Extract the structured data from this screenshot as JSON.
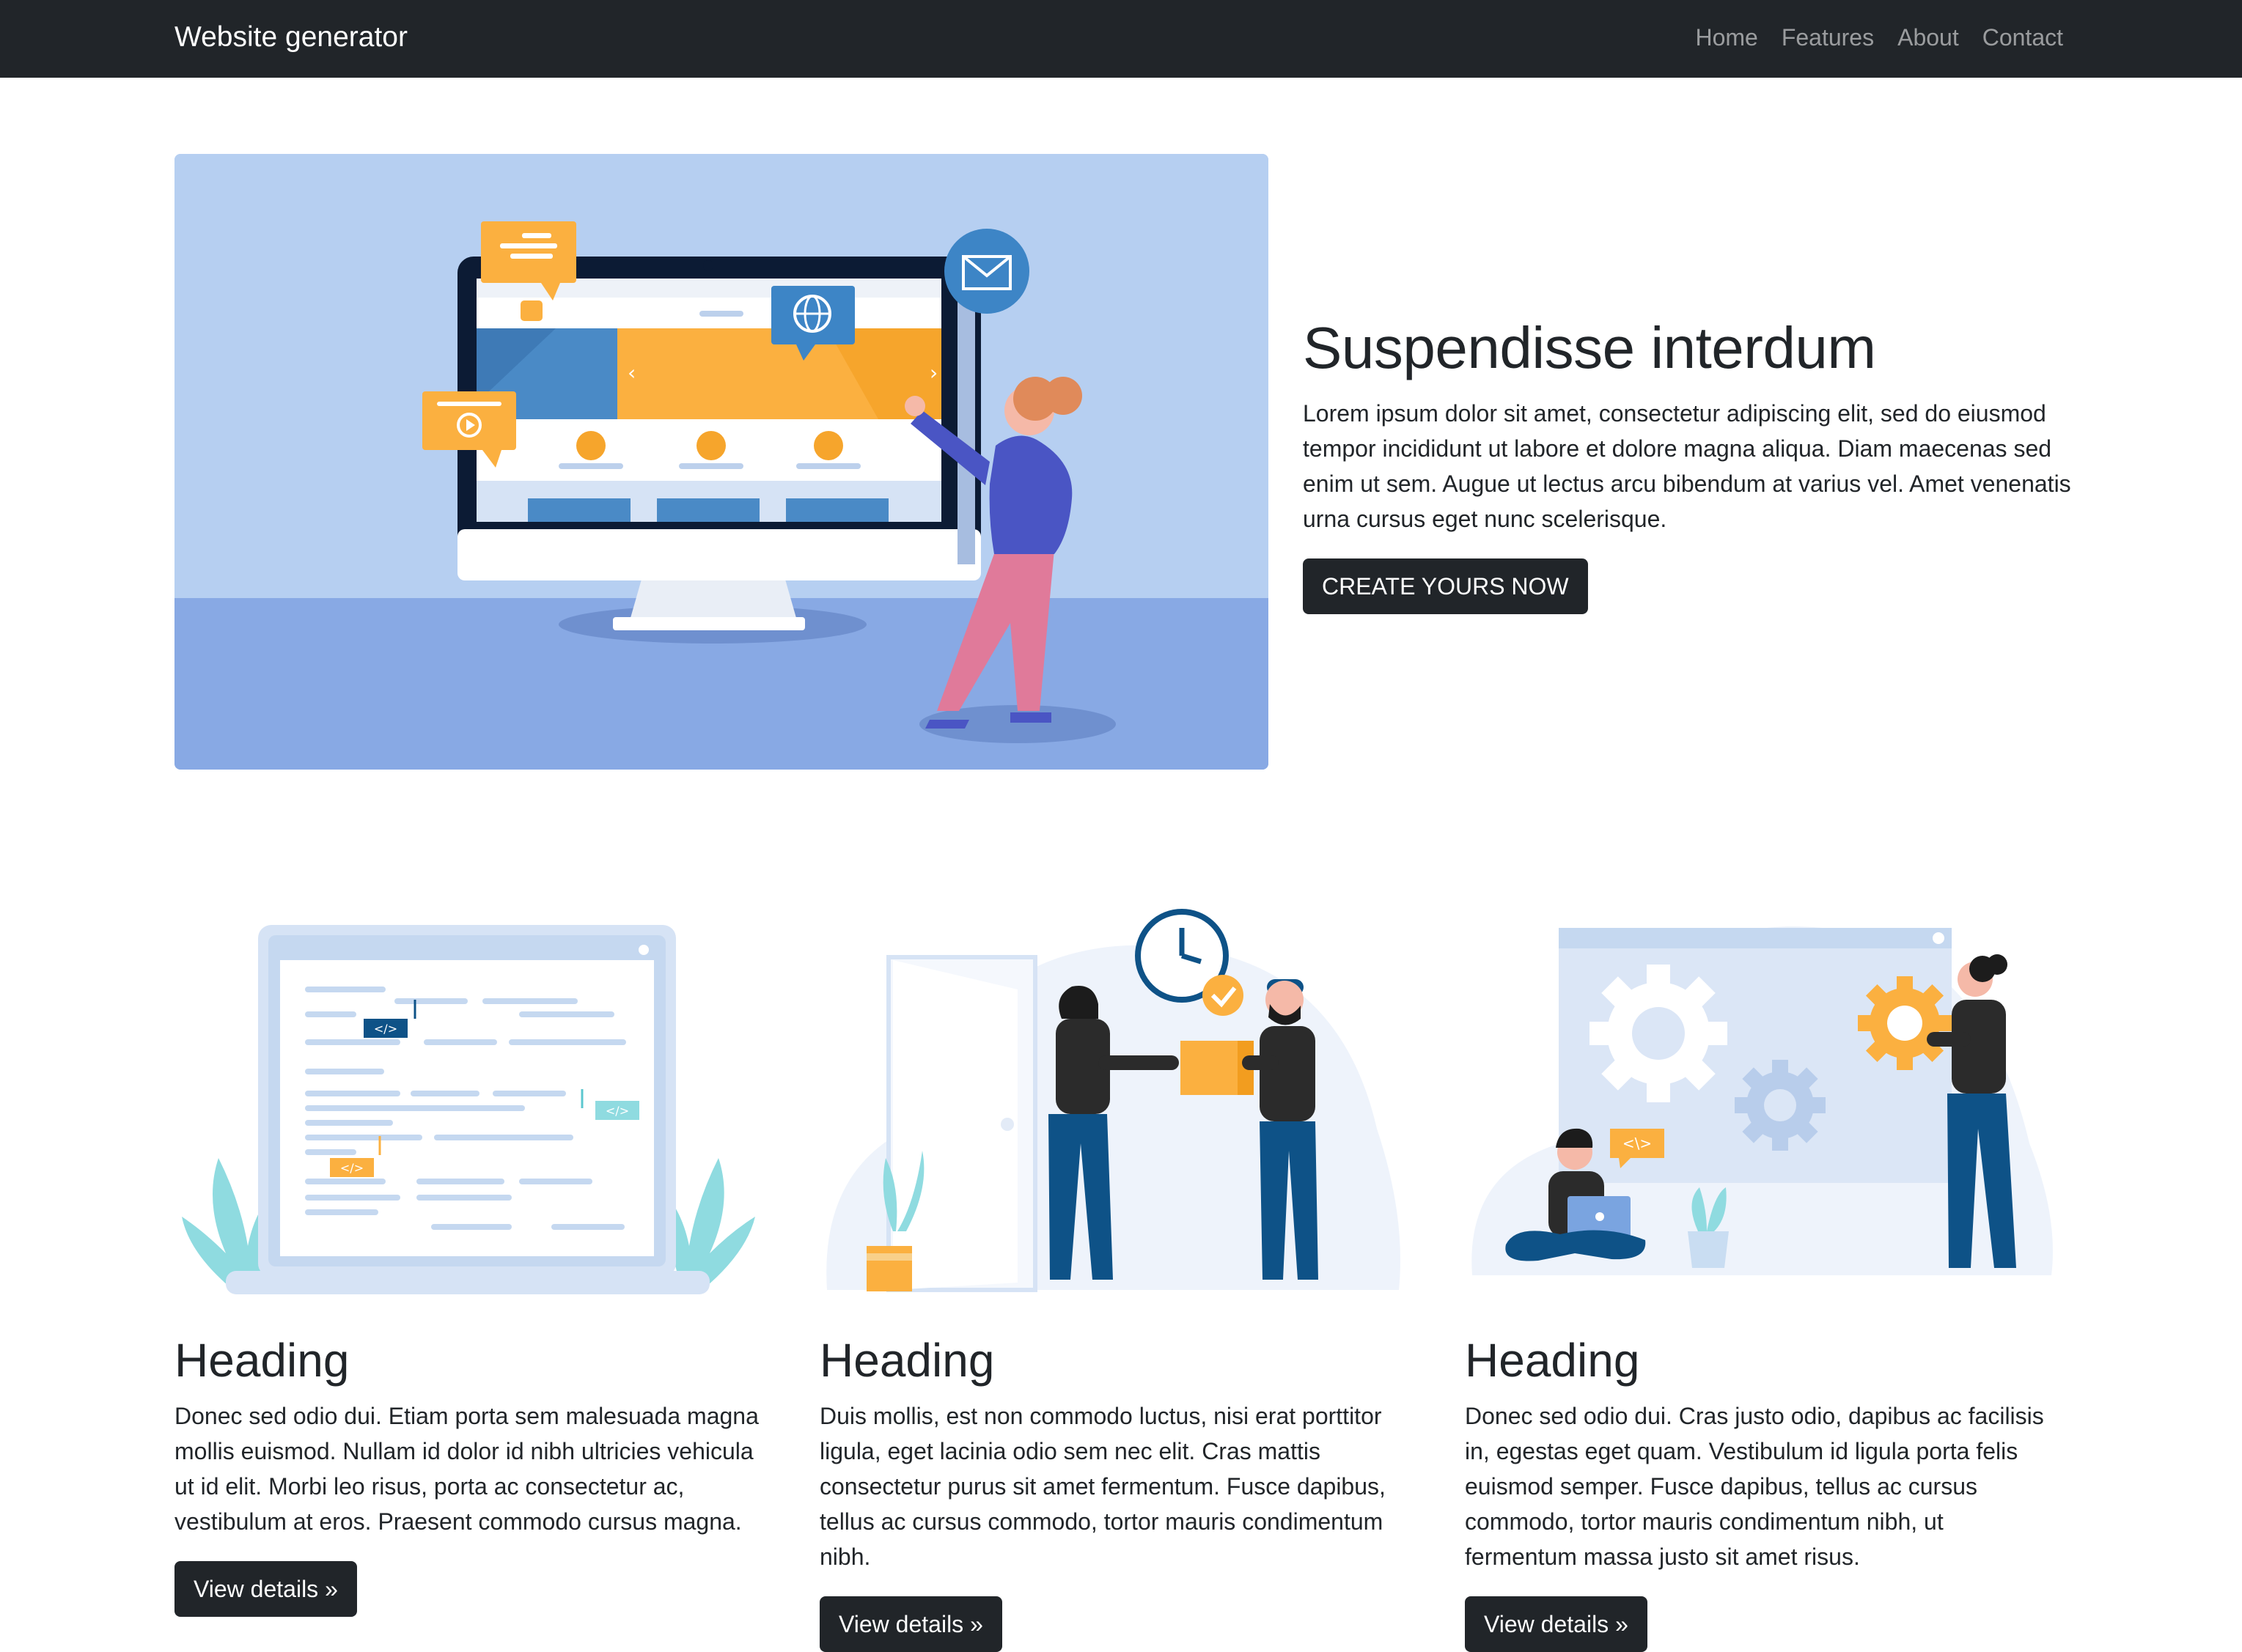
{
  "navbar": {
    "brand": "Website generator",
    "links": [
      "Home",
      "Features",
      "About",
      "Contact"
    ]
  },
  "hero": {
    "title": "Suspendisse interdum",
    "text": "Lorem ipsum dolor sit amet, consectetur adipiscing elit, sed do eiusmod tempor incididunt ut labore et dolore magna aliqua. Diam maecenas sed enim ut sem. Augue ut lectus arcu bibendum at varius vel. Amet venenatis urna cursus eget nunc scelerisque.",
    "button": "CREATE YOURS NOW"
  },
  "features": [
    {
      "heading": "Heading",
      "text": "Donec sed odio dui. Etiam porta sem malesuada magna mollis euismod. Nullam id dolor id nibh ultricies vehicula ut id elit. Morbi leo risus, porta ac consectetur ac, vestibulum at eros. Praesent commodo cursus magna.",
      "button": "View details »"
    },
    {
      "heading": "Heading",
      "text": "Duis mollis, est non commodo luctus, nisi erat porttitor ligula, eget lacinia odio sem nec elit. Cras mattis consectetur purus sit amet fermentum. Fusce dapibus, tellus ac cursus commodo, tortor mauris condimentum nibh.",
      "button": "View details »"
    },
    {
      "heading": "Heading",
      "text": "Donec sed odio dui. Cras justo odio, dapibus ac facilisis in, egestas eget quam. Vestibulum id ligula porta felis euismod semper. Fusce dapibus, tellus ac cursus commodo, tortor mauris condimentum nibh, ut fermentum massa justo sit amet risus.",
      "button": "View details »"
    }
  ],
  "illustration_text": {
    "code_tag": "</>",
    "code_tag_alt": "<\\>"
  },
  "colors": {
    "navbar_bg": "#212529",
    "hero_bg": "#b6cff1",
    "accent_orange": "#fbb040",
    "accent_blue": "#3d85c6",
    "navy": "#0e5287"
  }
}
